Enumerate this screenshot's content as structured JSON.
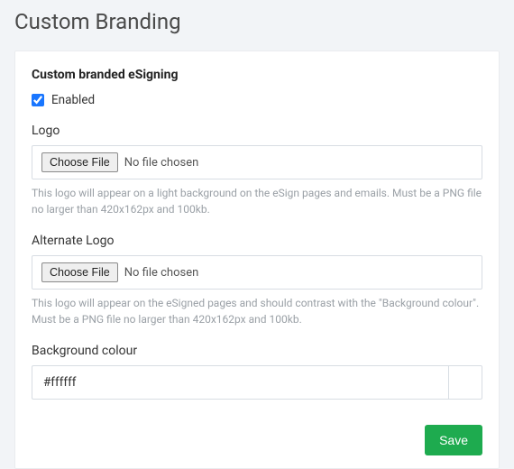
{
  "page": {
    "title": "Custom Branding"
  },
  "card": {
    "section_title": "Custom branded eSigning",
    "enabled": {
      "label": "Enabled",
      "checked": true
    },
    "logo": {
      "label": "Logo",
      "button": "Choose File",
      "status": "No file chosen",
      "help": "This logo will appear on a light background on the eSign pages and emails. Must be a PNG file no larger than 420x162px and 100kb."
    },
    "alt_logo": {
      "label": "Alternate Logo",
      "button": "Choose File",
      "status": "No file chosen",
      "help": "This logo will appear on the eSigned pages and should contrast with the \"Background colour\". Must be a PNG file no larger than 420x162px and 100kb."
    },
    "bg_colour": {
      "label": "Background colour",
      "value": "#ffffff"
    },
    "actions": {
      "save": "Save"
    }
  }
}
